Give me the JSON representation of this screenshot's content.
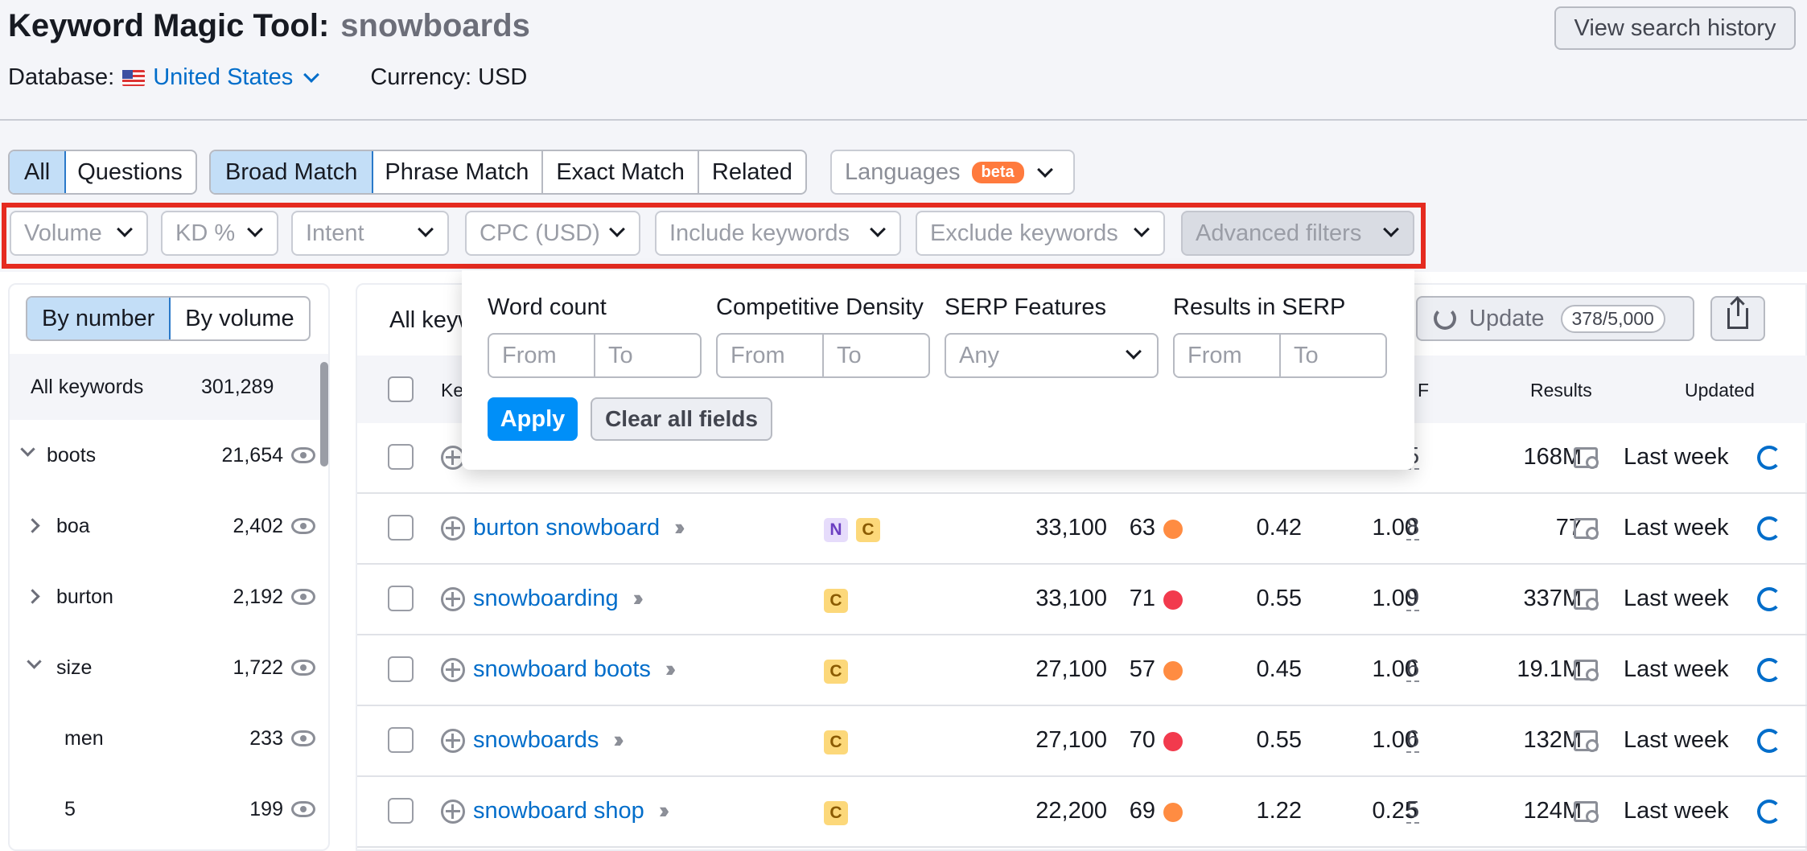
{
  "header": {
    "title": "Keyword Magic Tool:",
    "query": "snowboards",
    "history_button": "View search history",
    "database_label": "Database:",
    "database_value": "United States",
    "currency": "Currency: USD"
  },
  "match_tabs": {
    "group1": [
      "All",
      "Questions"
    ],
    "group2": [
      "Broad Match",
      "Phrase Match",
      "Exact Match",
      "Related"
    ],
    "languages": "Languages",
    "beta": "beta"
  },
  "filters": [
    "Volume",
    "KD %",
    "Intent",
    "CPC (USD)",
    "Include keywords",
    "Exclude keywords",
    "Advanced filters"
  ],
  "advanced_popup": {
    "word_count": "Word count",
    "competitive_density": "Competitive Density",
    "serp_features": "SERP Features",
    "results_in_serp": "Results in SERP",
    "from": "From",
    "to": "To",
    "any": "Any",
    "apply": "Apply",
    "clear": "Clear all fields"
  },
  "left_panel": {
    "tabs": [
      "By number",
      "By volume"
    ],
    "all_keywords_label": "All keywords",
    "all_keywords_count": "301,289",
    "items": [
      {
        "label": "boots",
        "count": "21,654"
      },
      {
        "label": "boa",
        "count": "2,402"
      },
      {
        "label": "burton",
        "count": "2,192"
      },
      {
        "label": "size",
        "count": "1,722"
      },
      {
        "label": "men",
        "count": "233"
      },
      {
        "label": "5",
        "count": "199"
      }
    ]
  },
  "main": {
    "head_text": "All keyw",
    "update": "Update",
    "update_count": "378/5,000",
    "columns": {
      "keyword": "Ke",
      "sf": "F",
      "results": "Results",
      "updated": "Updated"
    },
    "first_row_partial": {
      "sf": "5",
      "results": "168M",
      "updated": "Last week"
    },
    "rows": [
      {
        "keyword": "burton snowboard",
        "intents": [
          "N",
          "C"
        ],
        "volume": "33,100",
        "kd": "63",
        "kd_color": "#ff8c42",
        "cpc": "0.42",
        "com": "1.00",
        "sf": "8",
        "results": "77",
        "updated": "Last week"
      },
      {
        "keyword": "snowboarding",
        "intents": [
          "C"
        ],
        "volume": "33,100",
        "kd": "71",
        "kd_color": "#f23a4d",
        "cpc": "0.55",
        "com": "1.00",
        "sf": "9",
        "results": "337M",
        "updated": "Last week"
      },
      {
        "keyword": "snowboard boots",
        "intents": [
          "C"
        ],
        "volume": "27,100",
        "kd": "57",
        "kd_color": "#ff8c42",
        "cpc": "0.45",
        "com": "1.00",
        "sf": "6",
        "results": "19.1M",
        "updated": "Last week"
      },
      {
        "keyword": "snowboards",
        "intents": [
          "C"
        ],
        "volume": "27,100",
        "kd": "70",
        "kd_color": "#f23a4d",
        "cpc": "0.55",
        "com": "1.00",
        "sf": "6",
        "results": "132M",
        "updated": "Last week"
      },
      {
        "keyword": "snowboard shop",
        "intents": [
          "C"
        ],
        "volume": "22,200",
        "kd": "69",
        "kd_color": "#ff8c42",
        "cpc": "1.22",
        "com": "0.25",
        "sf": "5",
        "results": "124M",
        "updated": "Last week"
      }
    ]
  }
}
